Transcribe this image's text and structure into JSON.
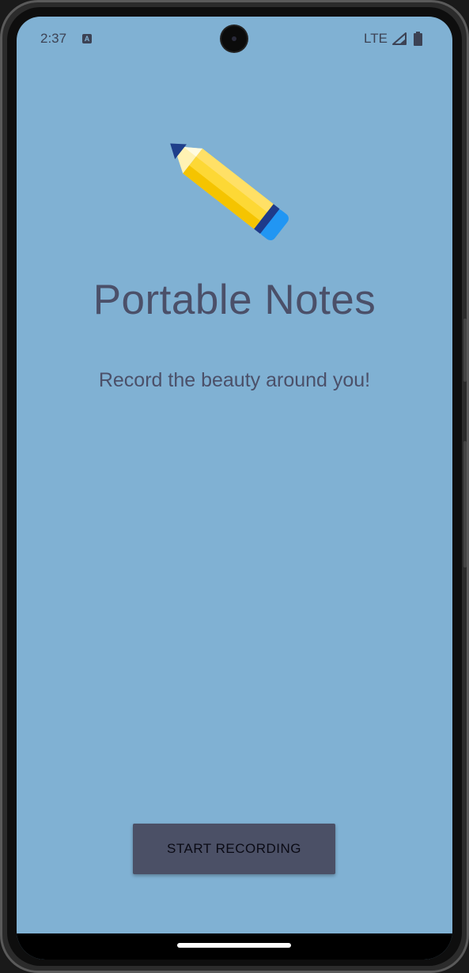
{
  "status_bar": {
    "time": "2:37",
    "notification_icon": "a-icon",
    "network": "LTE",
    "signal_icon": "signal-icon",
    "battery_icon": "battery-icon"
  },
  "app": {
    "logo_icon": "pencil-icon",
    "title": "Portable Notes",
    "subtitle": "Record the beauty around you!",
    "start_button_label": "START RECORDING"
  },
  "colors": {
    "background": "#80b1d3",
    "text": "#4b5069",
    "button": "#4b5066"
  }
}
